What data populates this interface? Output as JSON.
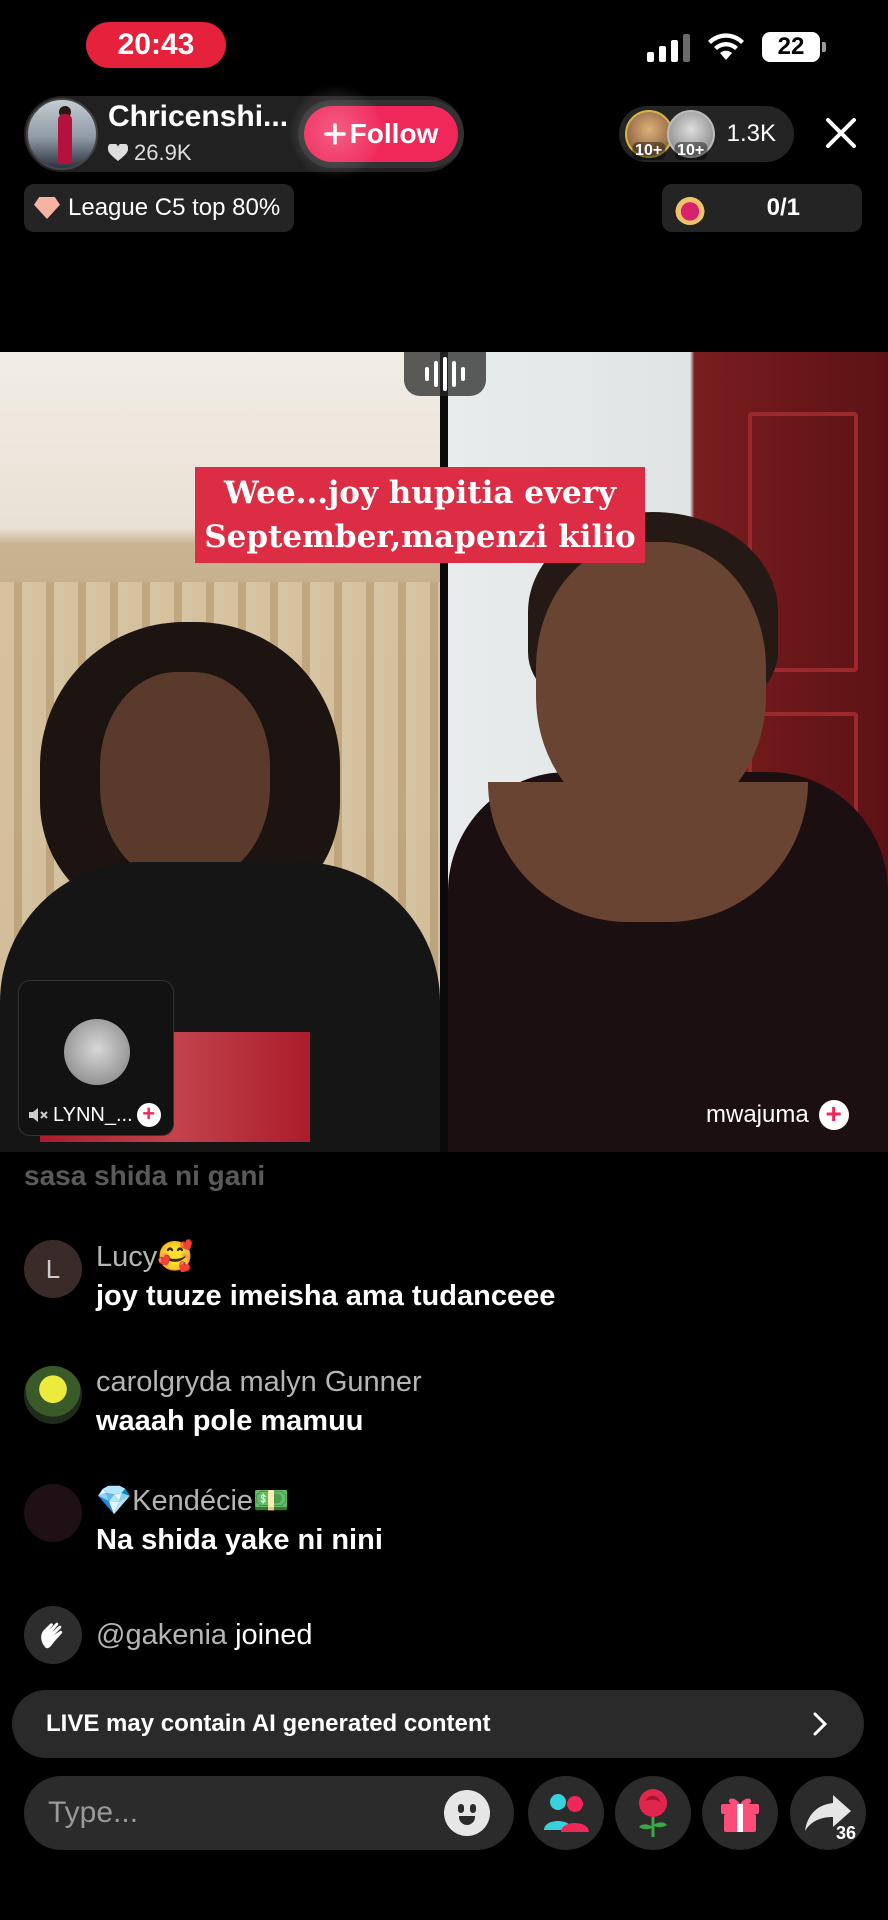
{
  "status_bar": {
    "time": "20:43",
    "battery": "22"
  },
  "host": {
    "name": "Chricenshi...",
    "likes": "26.9K",
    "follow_label": "Follow"
  },
  "viewers": {
    "badge_a": "10+",
    "badge_b": "10+",
    "count": "1.3K"
  },
  "league": {
    "label": "League C5 top 80%"
  },
  "goal": {
    "progress": "0/1"
  },
  "video": {
    "caption_line1": "Wee...joy hupitia every",
    "caption_line2": "September,mapenzi kilio",
    "guest_name": "LYNN_...",
    "cohost_name": "mwajuma"
  },
  "comments": {
    "faded_text": "sasa shida ni gani",
    "items": [
      {
        "avatar_letter": "L",
        "name": "Lucy🥰",
        "text": "joy tuuze imeisha ama tudanceee"
      },
      {
        "avatar_letter": "",
        "name": "carolgryda malyn Gunner",
        "text": "waaah pole mamuu"
      },
      {
        "avatar_letter": "",
        "name": "💎Kendécie💵",
        "text": "Na shida yake ni nini"
      }
    ],
    "joined_user": "@gakenia",
    "joined_text": "joined"
  },
  "disclaimer": {
    "text": "LIVE may contain AI generated content"
  },
  "input": {
    "placeholder": "Type..."
  },
  "actions": {
    "share_count": "36"
  },
  "colors": {
    "accent": "#f0285a",
    "caption_bg": "#dc2d44",
    "status_time_bg": "#e5213c"
  }
}
